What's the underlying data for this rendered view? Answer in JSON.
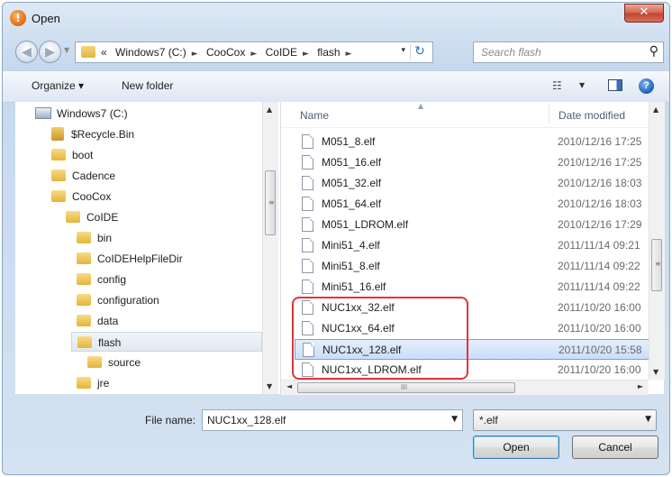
{
  "window": {
    "title": "Open",
    "close_glyph": "✕",
    "app_icon_glyph": "!"
  },
  "address": {
    "glyph_overflow": "«",
    "segments": [
      "Windows7 (C:)",
      "CooCox",
      "CoIDE",
      "flash"
    ],
    "separator": "►",
    "dropdown_glyph": "▾",
    "refresh_glyph": "↻"
  },
  "search": {
    "placeholder": "Search flash",
    "icon_glyph": "⚲"
  },
  "toolbar": {
    "organize_label": "Organize ▾",
    "new_folder_label": "New folder",
    "view_glyph": "☷",
    "view_dd_glyph": "▼",
    "help_glyph": "?"
  },
  "tree": {
    "items": [
      {
        "label": "Windows7 (C:)",
        "icon": "drive-icon"
      },
      {
        "label": "$Recycle.Bin",
        "icon": "recycle-bin-icon"
      },
      {
        "label": "boot",
        "icon": "folder-icon"
      },
      {
        "label": "Cadence",
        "icon": "folder-icon"
      },
      {
        "label": "CooCox",
        "icon": "folder-icon"
      },
      {
        "label": "CoIDE",
        "icon": "folder-icon"
      },
      {
        "label": "bin",
        "icon": "folder-icon"
      },
      {
        "label": "CoIDEHelpFileDir",
        "icon": "folder-icon"
      },
      {
        "label": "config",
        "icon": "folder-icon"
      },
      {
        "label": "configuration",
        "icon": "folder-icon"
      },
      {
        "label": "data",
        "icon": "folder-icon"
      },
      {
        "label": "flash",
        "icon": "folder-icon"
      },
      {
        "label": "source",
        "icon": "folder-icon"
      },
      {
        "label": "jre",
        "icon": "folder-icon"
      }
    ],
    "selected": "flash"
  },
  "files": {
    "columns": {
      "name": "Name",
      "date": "Date modified",
      "sort_glyph": "▲"
    },
    "rows": [
      {
        "name": "M051_8.elf",
        "date": "2010/12/16 17:25"
      },
      {
        "name": "M051_16.elf",
        "date": "2010/12/16 17:25"
      },
      {
        "name": "M051_32.elf",
        "date": "2010/12/16 18:03"
      },
      {
        "name": "M051_64.elf",
        "date": "2010/12/16 18:03"
      },
      {
        "name": "M051_LDROM.elf",
        "date": "2010/12/16 17:29"
      },
      {
        "name": "Mini51_4.elf",
        "date": "2011/11/14 09:21"
      },
      {
        "name": "Mini51_8.elf",
        "date": "2011/11/14 09:22"
      },
      {
        "name": "Mini51_16.elf",
        "date": "2011/11/14 09:22"
      },
      {
        "name": "NUC1xx_32.elf",
        "date": "2011/10/20 16:00"
      },
      {
        "name": "NUC1xx_64.elf",
        "date": "2011/10/20 16:00"
      },
      {
        "name": "NUC1xx_128.elf",
        "date": "2011/10/20 15:58"
      },
      {
        "name": "NUC1xx_LDROM.elf",
        "date": "2011/10/20 16:00"
      }
    ],
    "selected": "NUC1xx_128.elf",
    "highlighted": [
      "NUC1xx_32.elf",
      "NUC1xx_64.elf",
      "NUC1xx_128.elf",
      "NUC1xx_LDROM.elf"
    ],
    "highlight_color": "#e2343b"
  },
  "scroll": {
    "up": "▲",
    "down": "▼",
    "left": "◄",
    "right": "►",
    "grip_v": "≡",
    "grip_h": "III"
  },
  "bottom": {
    "file_name_label": "File name:",
    "file_name_value": "NUC1xx_128.elf",
    "file_type_value": "*.elf",
    "dropdown_glyph": "▼",
    "open_label": "Open",
    "cancel_label": "Cancel"
  }
}
